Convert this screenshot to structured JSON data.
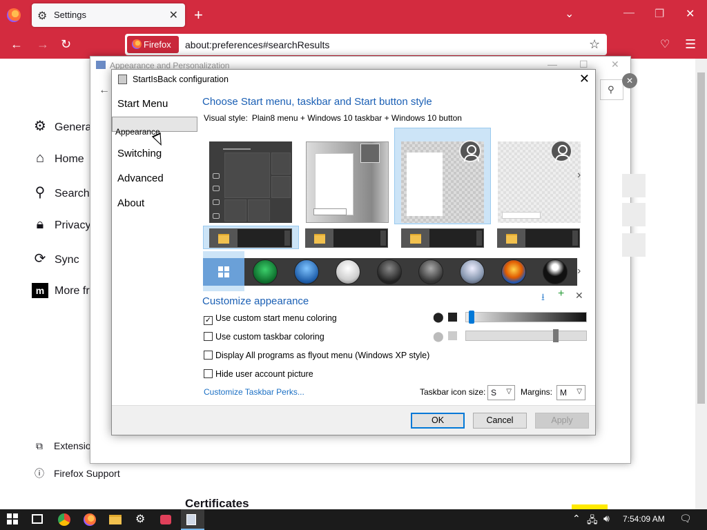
{
  "firefox": {
    "tab_title": "Settings",
    "url_identity": "Firefox",
    "url": "about:preferences#searchResults",
    "sidebar": [
      {
        "label": "General",
        "icon": "gear-icon"
      },
      {
        "label": "Home",
        "icon": "home-icon"
      },
      {
        "label": "Search",
        "icon": "search-icon"
      },
      {
        "label": "Privacy",
        "icon": "lock-icon"
      },
      {
        "label": "Sync",
        "icon": "sync-icon"
      },
      {
        "label": "More fr",
        "icon": "mozilla-icon"
      }
    ],
    "extensions_label": "Extension",
    "support_label": "Firefox Support",
    "section_heading": "Certificates"
  },
  "ap_window": {
    "title": "Appearance and Personalization"
  },
  "dialog": {
    "title": "StartIsBack configuration",
    "nav": [
      "Start Menu",
      "Appearance",
      "Switching",
      "Advanced",
      "About"
    ],
    "selected_nav": "Appearance",
    "heading_style": "Choose Start menu, taskbar and Start button style",
    "visual_style_label": "Visual style:",
    "visual_style_value": "Plain8 menu + Windows 10 taskbar + Windows 10 button",
    "heading_customize": "Customize appearance",
    "options": [
      {
        "label": "Use custom start menu coloring",
        "checked": true
      },
      {
        "label": "Use custom taskbar coloring",
        "checked": false
      },
      {
        "label": "Display All programs as flyout menu (Windows XP style)",
        "checked": false
      },
      {
        "label": "Hide user account picture",
        "checked": false
      }
    ],
    "perks_link": "Customize Taskbar Perks...",
    "icon_size_label": "Taskbar icon size:",
    "icon_size_value": "S",
    "margins_label": "Margins:",
    "margins_value": "M",
    "ok_label": "OK",
    "cancel_label": "Cancel",
    "apply_label": "Apply",
    "start_menu_opacity": 0.02,
    "taskbar_opacity": 0.75,
    "colors": {
      "accent": "#1a5fb4",
      "selection": "#cce4f7",
      "link": "#1a6fc4"
    }
  },
  "taskbar": {
    "clock": "7:54:09 AM"
  }
}
